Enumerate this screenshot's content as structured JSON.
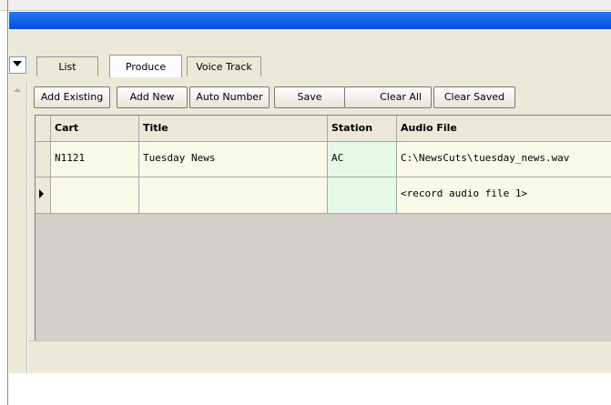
{
  "tabs": [
    {
      "label": "List"
    },
    {
      "label": "Produce"
    },
    {
      "label": "Voice Track"
    }
  ],
  "toolbar": {
    "add_existing": "Add Existing",
    "add_new": "Add New",
    "auto_number": "Auto Number",
    "save": "Save",
    "clear_all": "Clear All",
    "clear_saved": "Clear Saved"
  },
  "grid": {
    "columns": [
      "Cart",
      "Title",
      "Station",
      "Audio File"
    ],
    "rows": [
      {
        "cart": "N1121",
        "title": "Tuesday News",
        "station": "AC",
        "audio_file": "C:\\NewsCuts\\tuesday_news.wav"
      },
      {
        "cart": "",
        "title": "",
        "station": "",
        "audio_file": "<record audio file 1>"
      }
    ]
  },
  "colors": {
    "titlebar": "#0a5fe8",
    "row_cream": "#fafae8",
    "row_green": "#e6f8e6",
    "chrome": "#ece9d8"
  }
}
